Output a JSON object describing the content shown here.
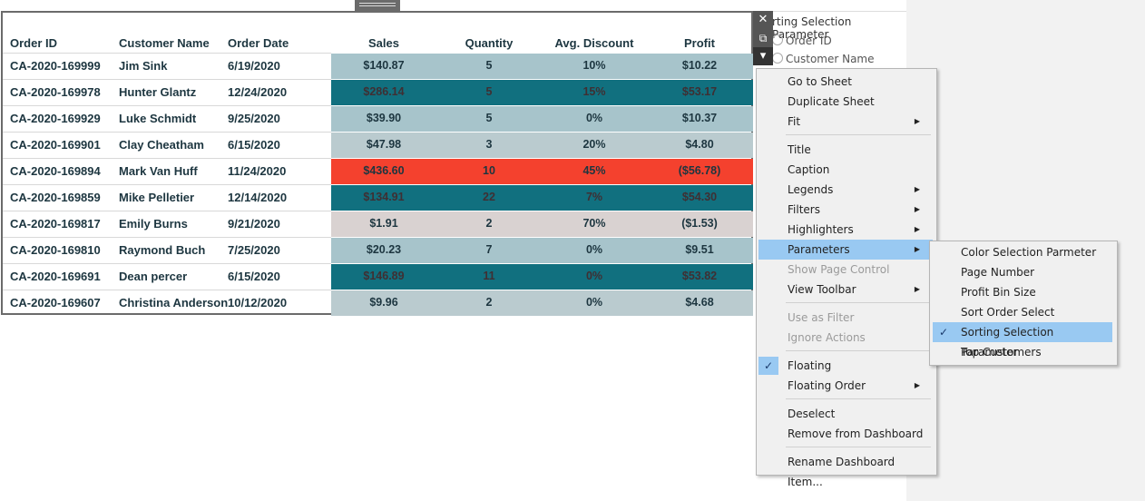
{
  "table": {
    "headers": [
      "Order ID",
      "Customer Name",
      "Order Date",
      "Sales",
      "Quantity",
      "Avg. Discount",
      "Profit"
    ],
    "rows": [
      {
        "order_id": "CA-2020-169999",
        "customer": "Jim Sink",
        "date": "6/19/2020",
        "sales": "$140.87",
        "quantity": "5",
        "discount": "10%",
        "profit": "$10.22",
        "color": "#a7c4cb"
      },
      {
        "order_id": "CA-2020-169978",
        "customer": "Hunter Glantz",
        "date": "12/24/2020",
        "sales": "$286.14",
        "quantity": "5",
        "discount": "15%",
        "profit": "$53.17",
        "color": "#11707f"
      },
      {
        "order_id": "CA-2020-169929",
        "customer": "Luke Schmidt",
        "date": "9/25/2020",
        "sales": "$39.90",
        "quantity": "5",
        "discount": "0%",
        "profit": "$10.37",
        "color": "#a7c4cb"
      },
      {
        "order_id": "CA-2020-169901",
        "customer": "Clay Cheatham",
        "date": "6/15/2020",
        "sales": "$47.98",
        "quantity": "3",
        "discount": "20%",
        "profit": "$4.80",
        "color": "#bacbcf"
      },
      {
        "order_id": "CA-2020-169894",
        "customer": "Mark Van Huff",
        "date": "11/24/2020",
        "sales": "$436.60",
        "quantity": "10",
        "discount": "45%",
        "profit": "($56.78)",
        "color": "#f4412e"
      },
      {
        "order_id": "CA-2020-169859",
        "customer": "Mike Pelletier",
        "date": "12/14/2020",
        "sales": "$134.91",
        "quantity": "22",
        "discount": "7%",
        "profit": "$54.30",
        "color": "#11707f"
      },
      {
        "order_id": "CA-2020-169817",
        "customer": "Emily Burns",
        "date": "9/21/2020",
        "sales": "$1.91",
        "quantity": "2",
        "discount": "70%",
        "profit": "($1.53)",
        "color": "#d9d2d1"
      },
      {
        "order_id": "CA-2020-169810",
        "customer": "Raymond Buch",
        "date": "7/25/2020",
        "sales": "$20.23",
        "quantity": "7",
        "discount": "0%",
        "profit": "$9.51",
        "color": "#a7c4cb"
      },
      {
        "order_id": "CA-2020-169691",
        "customer": "Dean percer",
        "date": "6/15/2020",
        "sales": "$146.89",
        "quantity": "11",
        "discount": "0%",
        "profit": "$53.82",
        "color": "#11707f"
      },
      {
        "order_id": "CA-2020-169607",
        "customer": "Christina Anderson",
        "date": "10/12/2020",
        "sales": "$9.96",
        "quantity": "2",
        "discount": "0%",
        "profit": "$4.68",
        "color": "#bacbcf"
      }
    ]
  },
  "selection_panel": {
    "title": "rting Selection Parameter",
    "options": [
      "Order ID",
      "Customer Name"
    ]
  },
  "controls": {
    "close": "✕",
    "open": "⧉",
    "more": "▾"
  },
  "menu": {
    "items": [
      {
        "label": "Go to Sheet",
        "submenu": false,
        "disabled": false
      },
      {
        "label": "Duplicate Sheet",
        "submenu": false,
        "disabled": false
      },
      {
        "label": "Fit",
        "submenu": true,
        "disabled": false
      },
      {
        "label": "Title",
        "submenu": false,
        "disabled": false
      },
      {
        "label": "Caption",
        "submenu": false,
        "disabled": false
      },
      {
        "label": "Legends",
        "submenu": true,
        "disabled": false
      },
      {
        "label": "Filters",
        "submenu": true,
        "disabled": false
      },
      {
        "label": "Highlighters",
        "submenu": true,
        "disabled": false
      },
      {
        "label": "Parameters",
        "submenu": true,
        "disabled": false,
        "highlighted": true
      },
      {
        "label": "Show Page Control",
        "submenu": false,
        "disabled": true
      },
      {
        "label": "View Toolbar",
        "submenu": true,
        "disabled": false
      },
      {
        "label": "Use as Filter",
        "submenu": false,
        "disabled": true
      },
      {
        "label": "Ignore Actions",
        "submenu": false,
        "disabled": true
      },
      {
        "label": "Floating",
        "submenu": false,
        "disabled": false,
        "checked": true
      },
      {
        "label": "Floating Order",
        "submenu": true,
        "disabled": false
      },
      {
        "label": "Deselect",
        "submenu": false,
        "disabled": false
      },
      {
        "label": "Remove from Dashboard",
        "submenu": false,
        "disabled": false
      },
      {
        "label": "Rename Dashboard Item...",
        "submenu": false,
        "disabled": false
      }
    ]
  },
  "submenu": {
    "items": [
      {
        "label": "Color Selection Parmeter",
        "checked": false
      },
      {
        "label": "Page Number",
        "checked": false
      },
      {
        "label": "Profit Bin Size",
        "checked": false
      },
      {
        "label": "Sort Order Select",
        "checked": false
      },
      {
        "label": "Sorting Selection Parameter",
        "checked": true
      },
      {
        "label": "Top Customers",
        "checked": false
      }
    ]
  },
  "colors": {
    "dark_teal": "#11707f",
    "light_teal": "#a7c4cb",
    "red": "#f4412e",
    "highlight": "#99c9f2"
  }
}
